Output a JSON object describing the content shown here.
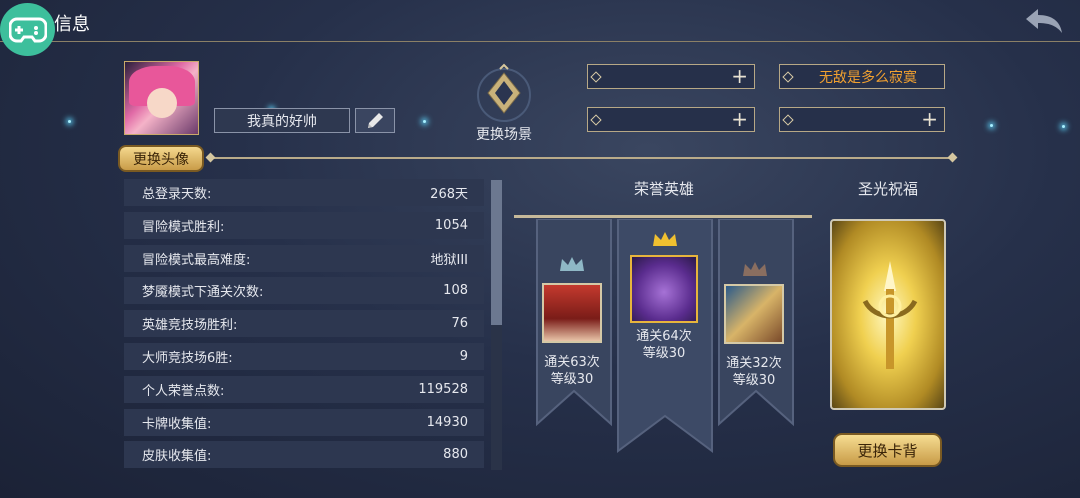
{
  "header": {
    "title": "信息"
  },
  "icons": {
    "game": "gamepad-icon",
    "back": "back-arrow-icon",
    "edit": "pencil-icon",
    "scene": "diamond-emblem-icon",
    "crown": "crown-icon"
  },
  "profile": {
    "nickname": "我真的好帅",
    "change_avatar_label": "更换头像"
  },
  "scene": {
    "label": "更换场景"
  },
  "slots": {
    "top_left": "",
    "top_right": "无敌是多么寂寞",
    "bottom_left": "",
    "bottom_right": ""
  },
  "stats": [
    {
      "label": "总登录天数:",
      "value": "268天"
    },
    {
      "label": "冒险模式胜利:",
      "value": "1054"
    },
    {
      "label": "冒险模式最高难度:",
      "value": "地狱III"
    },
    {
      "label": "梦魇模式下通关次数:",
      "value": "108"
    },
    {
      "label": "英雄竞技场胜利:",
      "value": "76"
    },
    {
      "label": "大师竞技场6胜:",
      "value": "9"
    },
    {
      "label": "个人荣誉点数:",
      "value": "119528"
    },
    {
      "label": "卡牌收集值:",
      "value": "14930"
    },
    {
      "label": "皮肤收集值:",
      "value": "880"
    }
  ],
  "honor": {
    "title": "荣誉英雄",
    "heroes": [
      {
        "line1": "通关63次",
        "line2": "等级30"
      },
      {
        "line1": "通关64次",
        "line2": "等级30"
      },
      {
        "line1": "通关32次",
        "line2": "等级30"
      }
    ]
  },
  "blessing": {
    "title": "圣光祝福",
    "change_back_label": "更换卡背"
  }
}
